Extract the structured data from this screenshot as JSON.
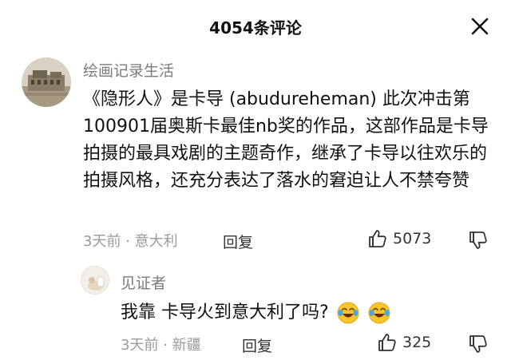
{
  "header": {
    "title": "4054条评论",
    "close_icon": "close-icon"
  },
  "comment": {
    "username": "绘画记录生活",
    "text": "《隐形人》是卡导 (abudureheman) 此次冲击第100901届奥斯卡最佳nb奖的作品，这部作品是卡导拍摄的最具戏剧的主题奇作，继承了卡导以往欢乐的拍摄风格，还充分表达了落水的窘迫让人不禁夸赞",
    "meta": "3天前 · 意大利",
    "reply_label": "回复",
    "like_count": "5073",
    "like_icon": "thumbs-up-icon",
    "dislike_icon": "thumbs-down-icon"
  },
  "reply": {
    "username": "见证者",
    "text": "我靠  卡导火到意大利了吗?",
    "emojis": [
      "laughing-crying-emoji",
      "laughing-crying-emoji"
    ],
    "meta": "3天前 · 新疆",
    "reply_label": "回复",
    "like_count": "325",
    "like_icon": "thumbs-up-icon",
    "dislike_icon": "thumbs-down-icon"
  },
  "colors": {
    "text_primary": "#111111",
    "text_secondary": "#7b7b7b",
    "text_meta": "#9a9a9a",
    "emoji_yellow": "#f7c52b",
    "emoji_tear": "#4aa8e8"
  }
}
